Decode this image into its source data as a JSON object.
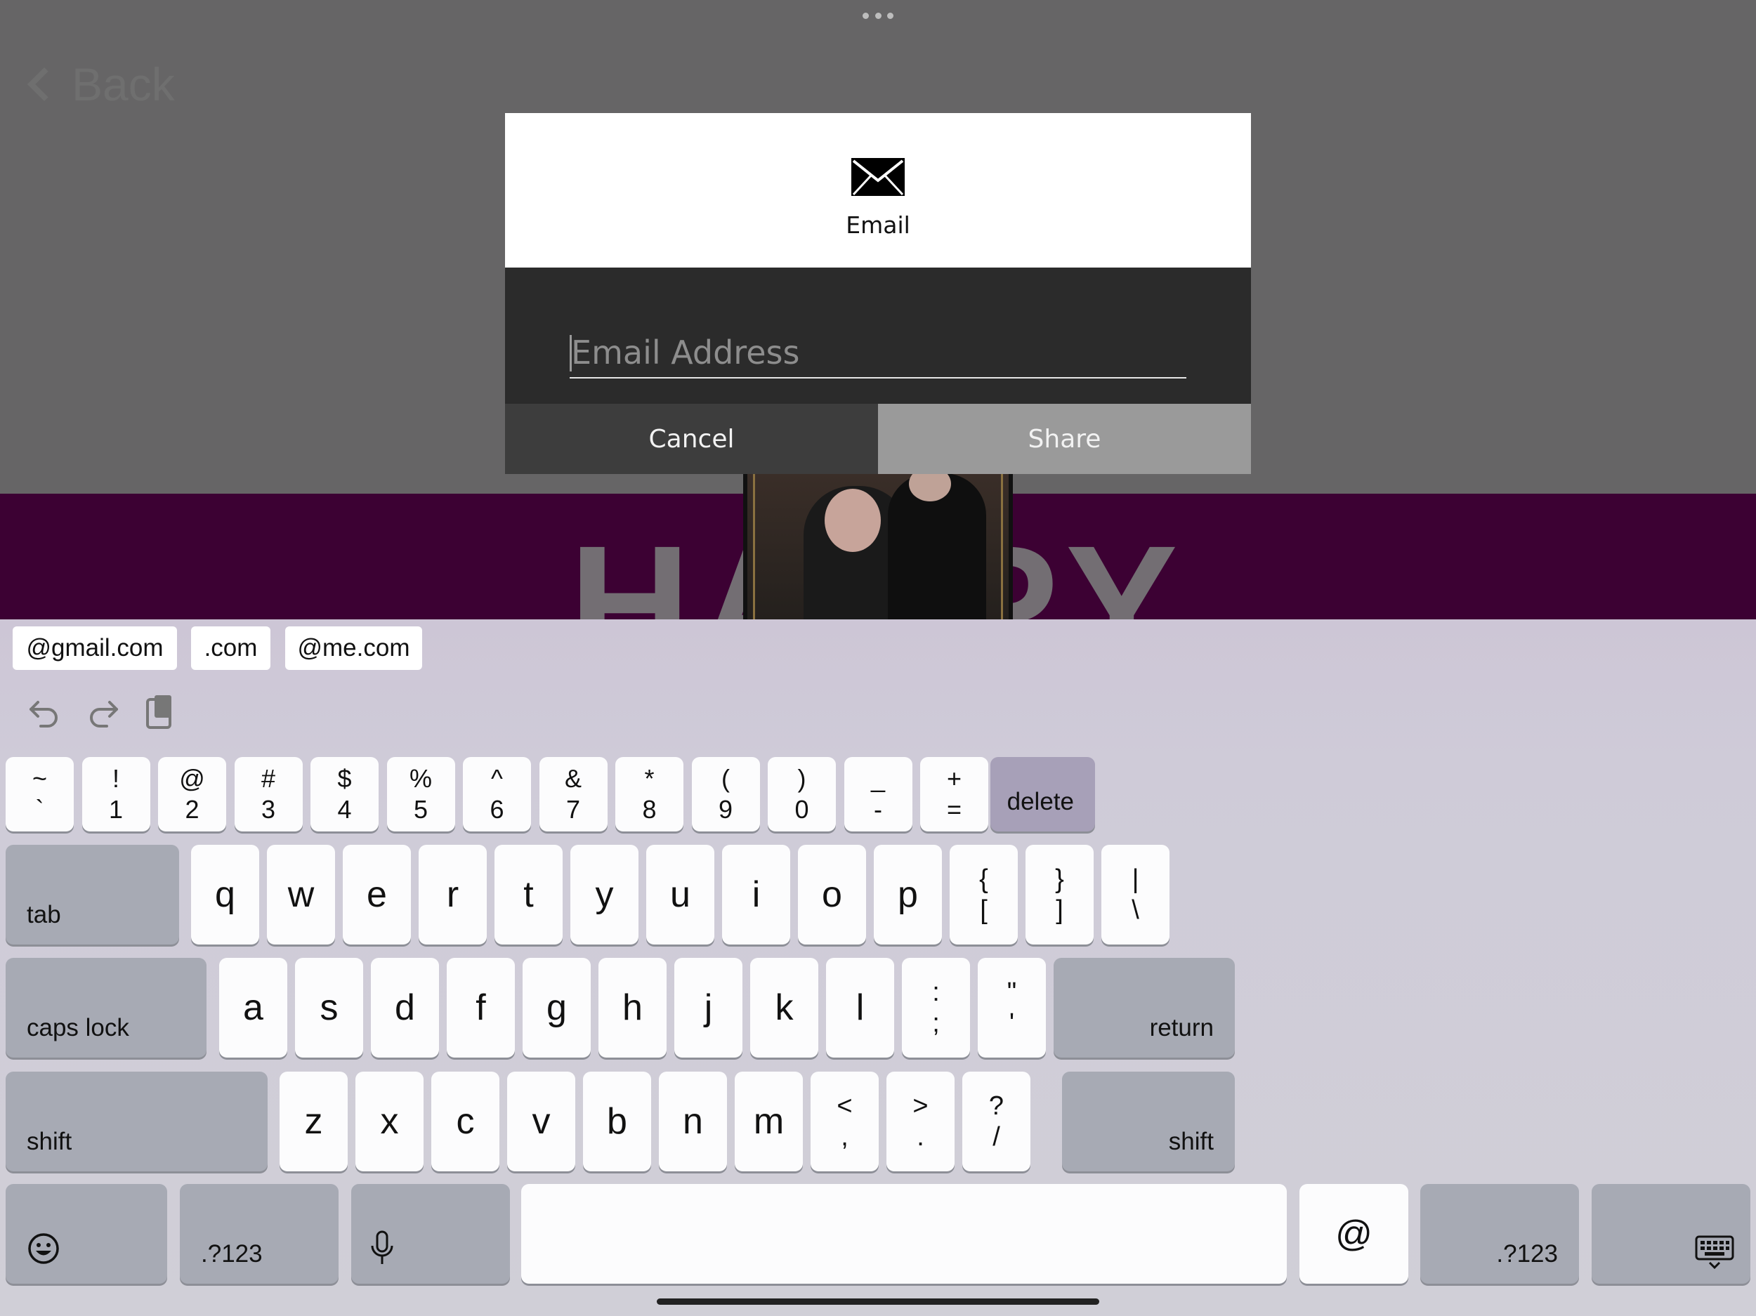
{
  "app": {
    "back_label": "Back"
  },
  "dialog": {
    "icon": "envelope-icon",
    "title": "Email",
    "email_placeholder": "Email Address",
    "email_value": "",
    "cancel_label": "Cancel",
    "share_label": "Share"
  },
  "keyboard": {
    "suggestions": [
      "@gmail.com",
      ".com",
      "@me.com"
    ],
    "toolbar_icons": [
      "undo-icon",
      "redo-icon",
      "paste-icon"
    ],
    "number_row": [
      {
        "top": "~",
        "bot": "`"
      },
      {
        "top": "!",
        "bot": "1"
      },
      {
        "top": "@",
        "bot": "2"
      },
      {
        "top": "#",
        "bot": "3"
      },
      {
        "top": "$",
        "bot": "4"
      },
      {
        "top": "%",
        "bot": "5"
      },
      {
        "top": "^",
        "bot": "6"
      },
      {
        "top": "&",
        "bot": "7"
      },
      {
        "top": "*",
        "bot": "8"
      },
      {
        "top": "(",
        "bot": "9"
      },
      {
        "top": ")",
        "bot": "0"
      },
      {
        "top": "_",
        "bot": "-"
      },
      {
        "top": "+",
        "bot": "="
      }
    ],
    "delete_label": "delete",
    "tab_label": "tab",
    "row1": [
      "q",
      "w",
      "e",
      "r",
      "t",
      "y",
      "u",
      "i",
      "o",
      "p"
    ],
    "row1_sym": [
      {
        "top": "{",
        "bot": "["
      },
      {
        "top": "}",
        "bot": "]"
      },
      {
        "top": "|",
        "bot": "\\"
      }
    ],
    "caps_label": "caps lock",
    "row2": [
      "a",
      "s",
      "d",
      "f",
      "g",
      "h",
      "j",
      "k",
      "l"
    ],
    "row2_sym": [
      {
        "top": ":",
        "bot": ";"
      },
      {
        "top": "\"",
        "bot": "'"
      }
    ],
    "return_label": "return",
    "shift_label": "shift",
    "row3": [
      "z",
      "x",
      "c",
      "v",
      "b",
      "n",
      "m"
    ],
    "row3_sym": [
      {
        "top": "<",
        "bot": ","
      },
      {
        "top": ">",
        "bot": "."
      },
      {
        "top": "?",
        "bot": "/"
      }
    ],
    "emoji_icon": "emoji-icon",
    "mode_label": ".?123",
    "mic_icon": "microphone-icon",
    "at_label": "@",
    "dismiss_icon": "keyboard-dismiss-icon"
  },
  "colors": {
    "dim_overlay": "#666566",
    "banner_purple": "#3c0133",
    "dialog_dark": "#2b2b2b",
    "share_button": "#9a9a9a",
    "cancel_button": "#3d3d3d"
  }
}
